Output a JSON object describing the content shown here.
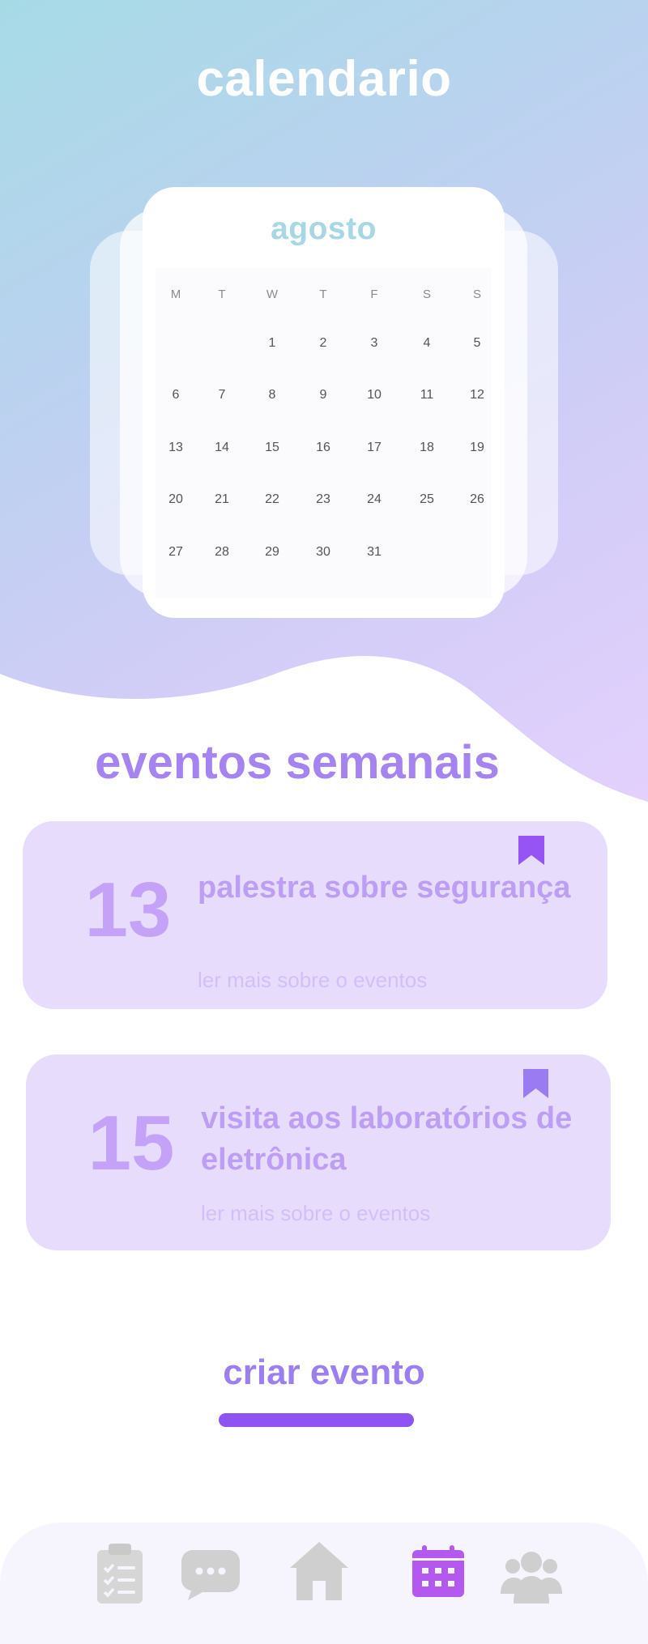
{
  "page_title": "calendario",
  "calendar": {
    "month": "agosto",
    "weekdays": [
      "M",
      "T",
      "W",
      "T",
      "F",
      "S",
      "S"
    ],
    "weeks": [
      [
        "",
        "",
        "1",
        "2",
        "3",
        "4",
        "5"
      ],
      [
        "6",
        "7",
        "8",
        "9",
        "10",
        "11",
        "12"
      ],
      [
        "13",
        "14",
        "15",
        "16",
        "17",
        "18",
        "19"
      ],
      [
        "20",
        "21",
        "22",
        "23",
        "24",
        "25",
        "26"
      ],
      [
        "27",
        "28",
        "29",
        "30",
        "31",
        "",
        ""
      ]
    ]
  },
  "events": {
    "title": "eventos semanais",
    "items": [
      {
        "day": "13",
        "title": "palestra sobre segurança",
        "link": "ler mais sobre o eventos",
        "bookmark_icon": "bookmark-icon",
        "bookmark_color": "#9654f4"
      },
      {
        "day": "15",
        "title": "visita aos laboratórios de eletrônica",
        "link": "ler mais sobre o eventos",
        "bookmark_icon": "bookmark-icon",
        "bookmark_color": "#9a7bf2"
      }
    ]
  },
  "create_event": {
    "label": "criar evento"
  },
  "bottom_nav": {
    "items": [
      {
        "icon": "clipboard-checklist-icon",
        "active": false
      },
      {
        "icon": "chat-bubble-icon",
        "active": false
      },
      {
        "icon": "home-icon",
        "active": false
      },
      {
        "icon": "calendar-icon",
        "active": true
      },
      {
        "icon": "users-group-icon",
        "active": false
      }
    ],
    "active_color": "#b459ef",
    "inactive_color": "#cfcfcf"
  },
  "colors": {
    "accent": "#a583f1",
    "hero_start": "#a6dbe6",
    "hero_end": "#e4d0fd",
    "event_card_bg": "#e8dcfd",
    "create_bar": "#8f52f3"
  }
}
